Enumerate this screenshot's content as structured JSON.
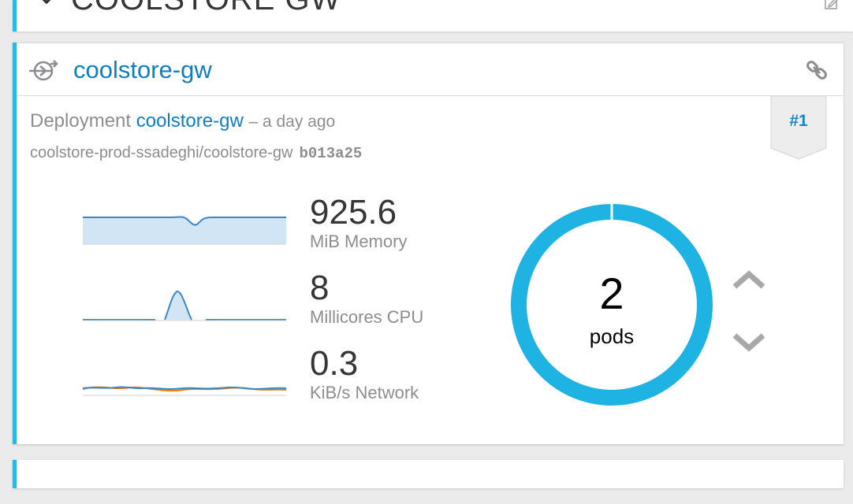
{
  "app": {
    "title": "COOLSTORE GW"
  },
  "service": {
    "name": "coolstore-gw"
  },
  "deployment": {
    "label": "Deployment",
    "name": "coolstore-gw",
    "time_ago": "– a day ago",
    "image": "coolstore-prod-ssadeghi/coolstore-gw",
    "commit": "b013a25",
    "revision": "#1"
  },
  "metrics": {
    "memory": {
      "value": "925.6",
      "unit": "MiB Memory"
    },
    "cpu": {
      "value": "8",
      "unit": "Millicores CPU"
    },
    "network": {
      "value": "0.3",
      "unit": "KiB/s Network"
    }
  },
  "pods": {
    "count": "2",
    "label": "pods"
  },
  "icons": {
    "collapse": "chevron-down-icon",
    "edit": "edit-icon",
    "service": "service-route-icon",
    "link": "link-icon",
    "scale_up": "chevron-up-icon",
    "scale_down": "chevron-down-icon"
  },
  "colors": {
    "accent": "#2bb7e6",
    "link": "#0f7fc3",
    "sparkline_line": "#3a87c8",
    "sparkline_fill": "#d1e5f4",
    "network_sent": "#ec7a08",
    "donut": "#1fb3e3",
    "muted": "#8b8d8f"
  }
}
